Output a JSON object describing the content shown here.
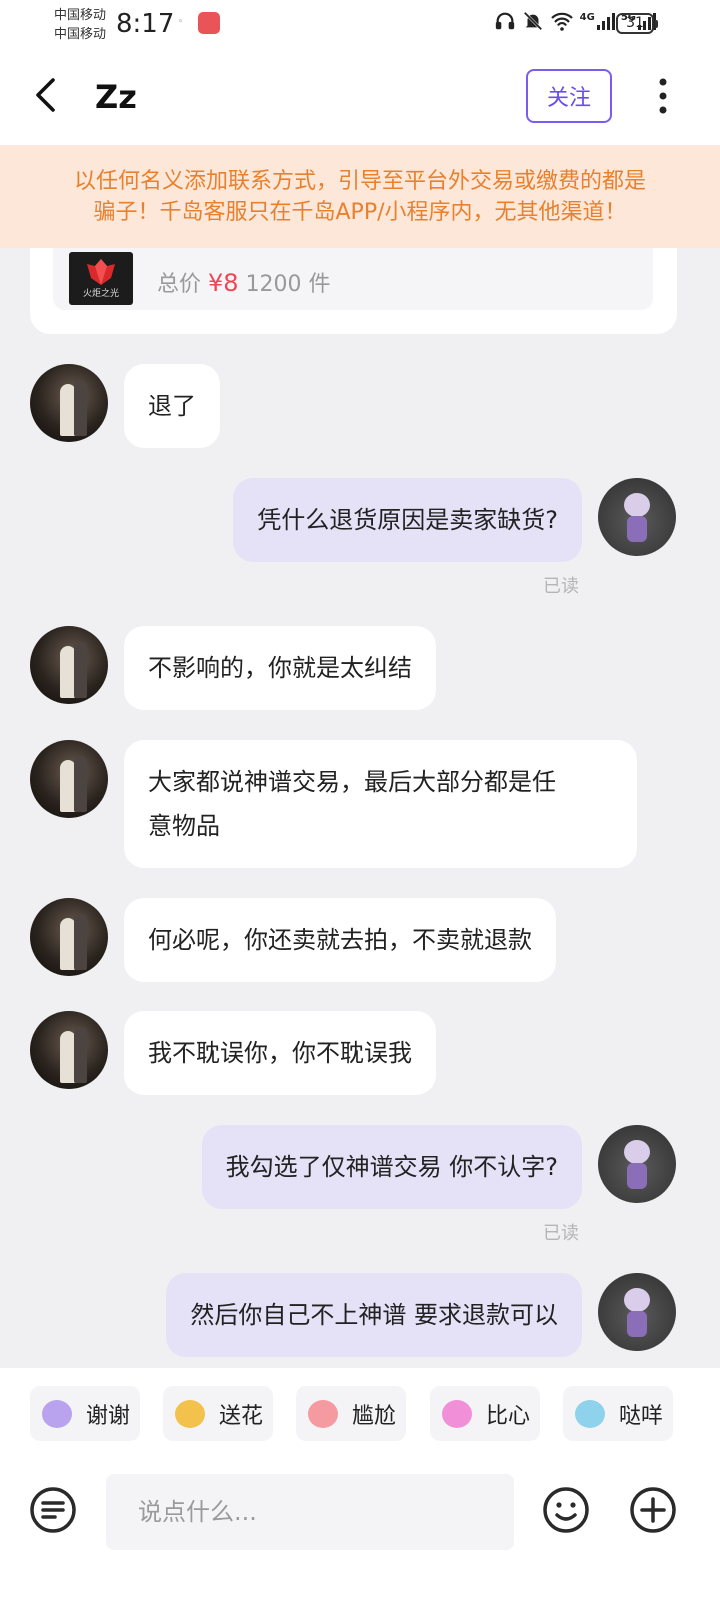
{
  "status_bar": {
    "carrier_1": "中国移动",
    "carrier_2": "中国移动",
    "time": "8:17",
    "net_1": "4G",
    "net_2": "5G",
    "battery": "31"
  },
  "header": {
    "back_icon": "chevron-left-icon",
    "title": "Zz",
    "follow_label": "关注",
    "more_icon": "more-vertical-icon"
  },
  "warning": {
    "line_1": "以任何名义添加联系方式，引导至平台外交易或缴费的都是",
    "line_2": "骗子！千岛客服只在千岛APP/小程序内，无其他渠道！",
    "color": "#e8812e",
    "background": "#fde7d9"
  },
  "product_card": {
    "thumbnail_label": "火炬之光",
    "price_prefix": "总价",
    "price": "¥8",
    "quantity": "1200 件"
  },
  "messages": [
    {
      "sender": "peer",
      "text": "退了"
    },
    {
      "sender": "me",
      "text": "凭什么退货原因是卖家缺货?",
      "status": "已读"
    },
    {
      "sender": "peer",
      "text": "不影响的，你就是太纠结"
    },
    {
      "sender": "peer",
      "line_1": "大家都说神谱交易，最后大部分都是任",
      "line_2": "意物品"
    },
    {
      "sender": "peer",
      "text": "何必呢，你还卖就去拍，不卖就退款"
    },
    {
      "sender": "peer",
      "text": "我不耽误你，你不耽误我"
    },
    {
      "sender": "me",
      "text": "我勾选了仅神谱交易 你不认字?",
      "status": "已读"
    },
    {
      "sender": "me",
      "text": "然后你自己不上神谱 要求退款可以"
    }
  ],
  "quick_replies": [
    {
      "label": "谢谢",
      "icon": "thanks-emoji-icon",
      "color": "#b9a2ee"
    },
    {
      "label": "送花",
      "icon": "flower-emoji-icon",
      "color": "#f2c24c"
    },
    {
      "label": "尴尬",
      "icon": "awkward-emoji-icon",
      "color": "#f59aa0"
    },
    {
      "label": "比心",
      "icon": "heart-emoji-icon",
      "color": "#f190d8"
    },
    {
      "label": "哒咩",
      "icon": "no-emoji-icon",
      "color": "#8fd2ec"
    }
  ],
  "input": {
    "placeholder": "说点什么...",
    "menu_icon": "list-menu-icon",
    "emoji_icon": "emoji-face-icon",
    "plus_icon": "plus-circle-icon"
  },
  "colors": {
    "accent": "#6a4ded",
    "my_bubble": "#e5e1f7",
    "peer_bubble": "#ffffff",
    "background": "#f0f0f2",
    "price": "#ef4656"
  }
}
